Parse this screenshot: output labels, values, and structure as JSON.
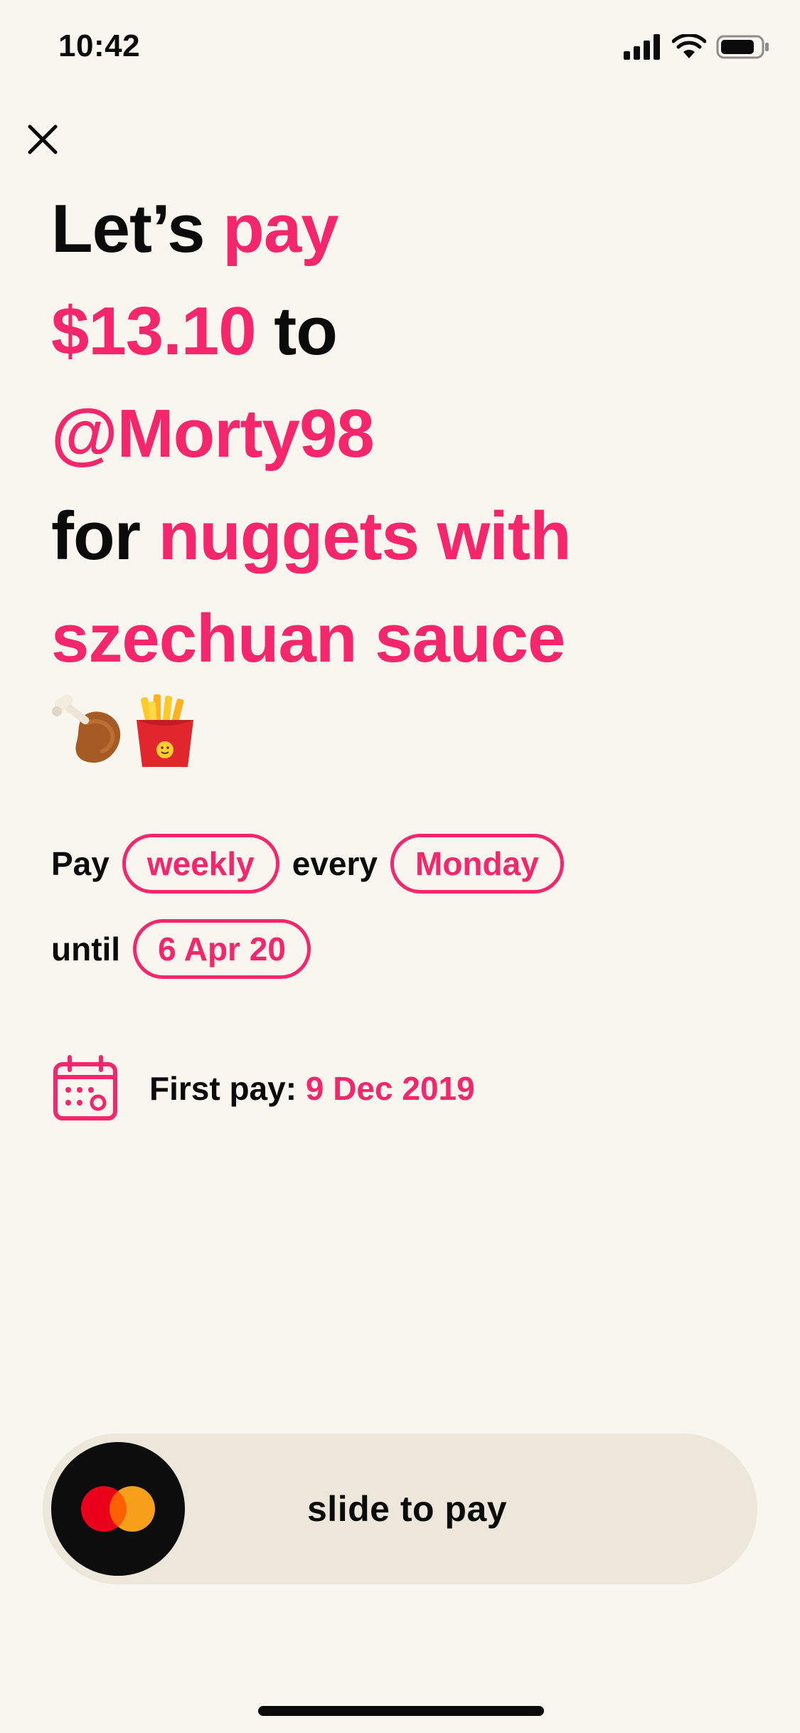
{
  "status_bar": {
    "time": "10:42",
    "icons": [
      "signal-icon",
      "wifi-icon",
      "battery-icon"
    ]
  },
  "close": {
    "icon": "close-icon"
  },
  "headline": {
    "lets": "Let’s",
    "pay": "pay",
    "amount": "$13.10",
    "to": "to",
    "recipient": "@Morty98",
    "for": "for",
    "item_line1": "nuggets with",
    "item_line2": "szechuan sauce",
    "emojis": [
      "poultry-leg-emoji",
      "fries-emoji"
    ]
  },
  "schedule": {
    "pay_word": "Pay",
    "frequency": "weekly",
    "every_word": "every",
    "day": "Monday",
    "until_word": "until",
    "end_date": "6 Apr 20"
  },
  "first_pay": {
    "icon": "calendar-icon",
    "label": "First pay:",
    "date": "9 Dec 2019"
  },
  "slider": {
    "label": "slide to pay",
    "thumb_icon": "mastercard-logo"
  },
  "colors": {
    "accent": "#f5266b",
    "background": "#f9f6ef",
    "slider_track": "#ece6db",
    "text": "#0b0b0b"
  }
}
